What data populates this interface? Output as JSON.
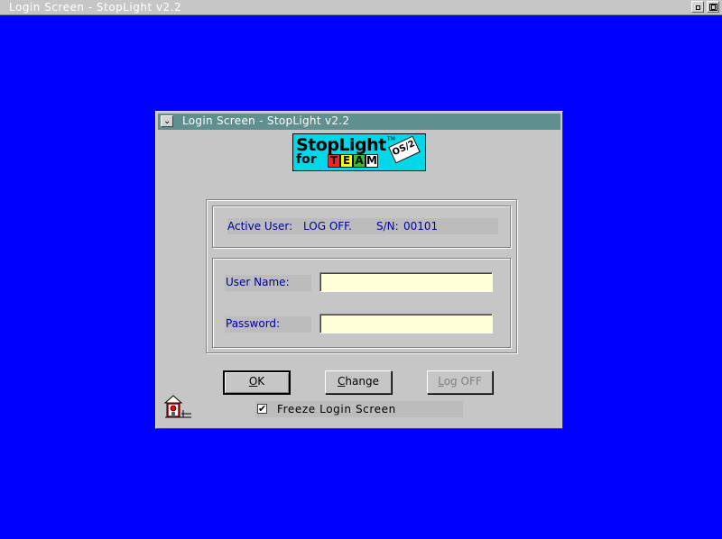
{
  "window": {
    "title": "Login Screen - StopLight v2.2",
    "minimize_icon": "minimize-icon",
    "restore_icon": "restore-icon"
  },
  "dialog": {
    "title": "Login Screen - StopLight v2.2",
    "system_menu_icon": "chevron-down-icon",
    "logo": {
      "line1": "StopLight",
      "trademark": "TM",
      "line2": "for",
      "team_letters": [
        "T",
        "E",
        "A",
        "M"
      ],
      "team_colors": [
        "#ff2020",
        "#ffff00",
        "#30c030",
        "#ffffff"
      ],
      "os_badge": "OS/2"
    },
    "status": {
      "active_user_label": "Active User:",
      "active_user_value": "LOG OFF.",
      "serial_label": "S/N:",
      "serial_value": "00101"
    },
    "form": {
      "user_name_label": "User Name:",
      "user_name_value": "",
      "password_label": "Password:",
      "password_value": ""
    },
    "buttons": {
      "ok": {
        "mnemonic": "O",
        "rest": "K",
        "enabled": true
      },
      "change": {
        "mnemonic": "C",
        "rest": "hange",
        "enabled": true
      },
      "logoff": {
        "mnemonic": "L",
        "rest": "og OFF",
        "enabled": false
      }
    },
    "freeze": {
      "label": "Freeze Login Screen",
      "checked": true,
      "check_glyph": "✔"
    },
    "corner_icon": "house-icon"
  },
  "colors": {
    "desktop": "#0000ff",
    "title_active": "#5f8f8f",
    "label_text": "#0000a0",
    "entry_bg": "#ffffd8",
    "logo_bg": "#00d8e8"
  }
}
